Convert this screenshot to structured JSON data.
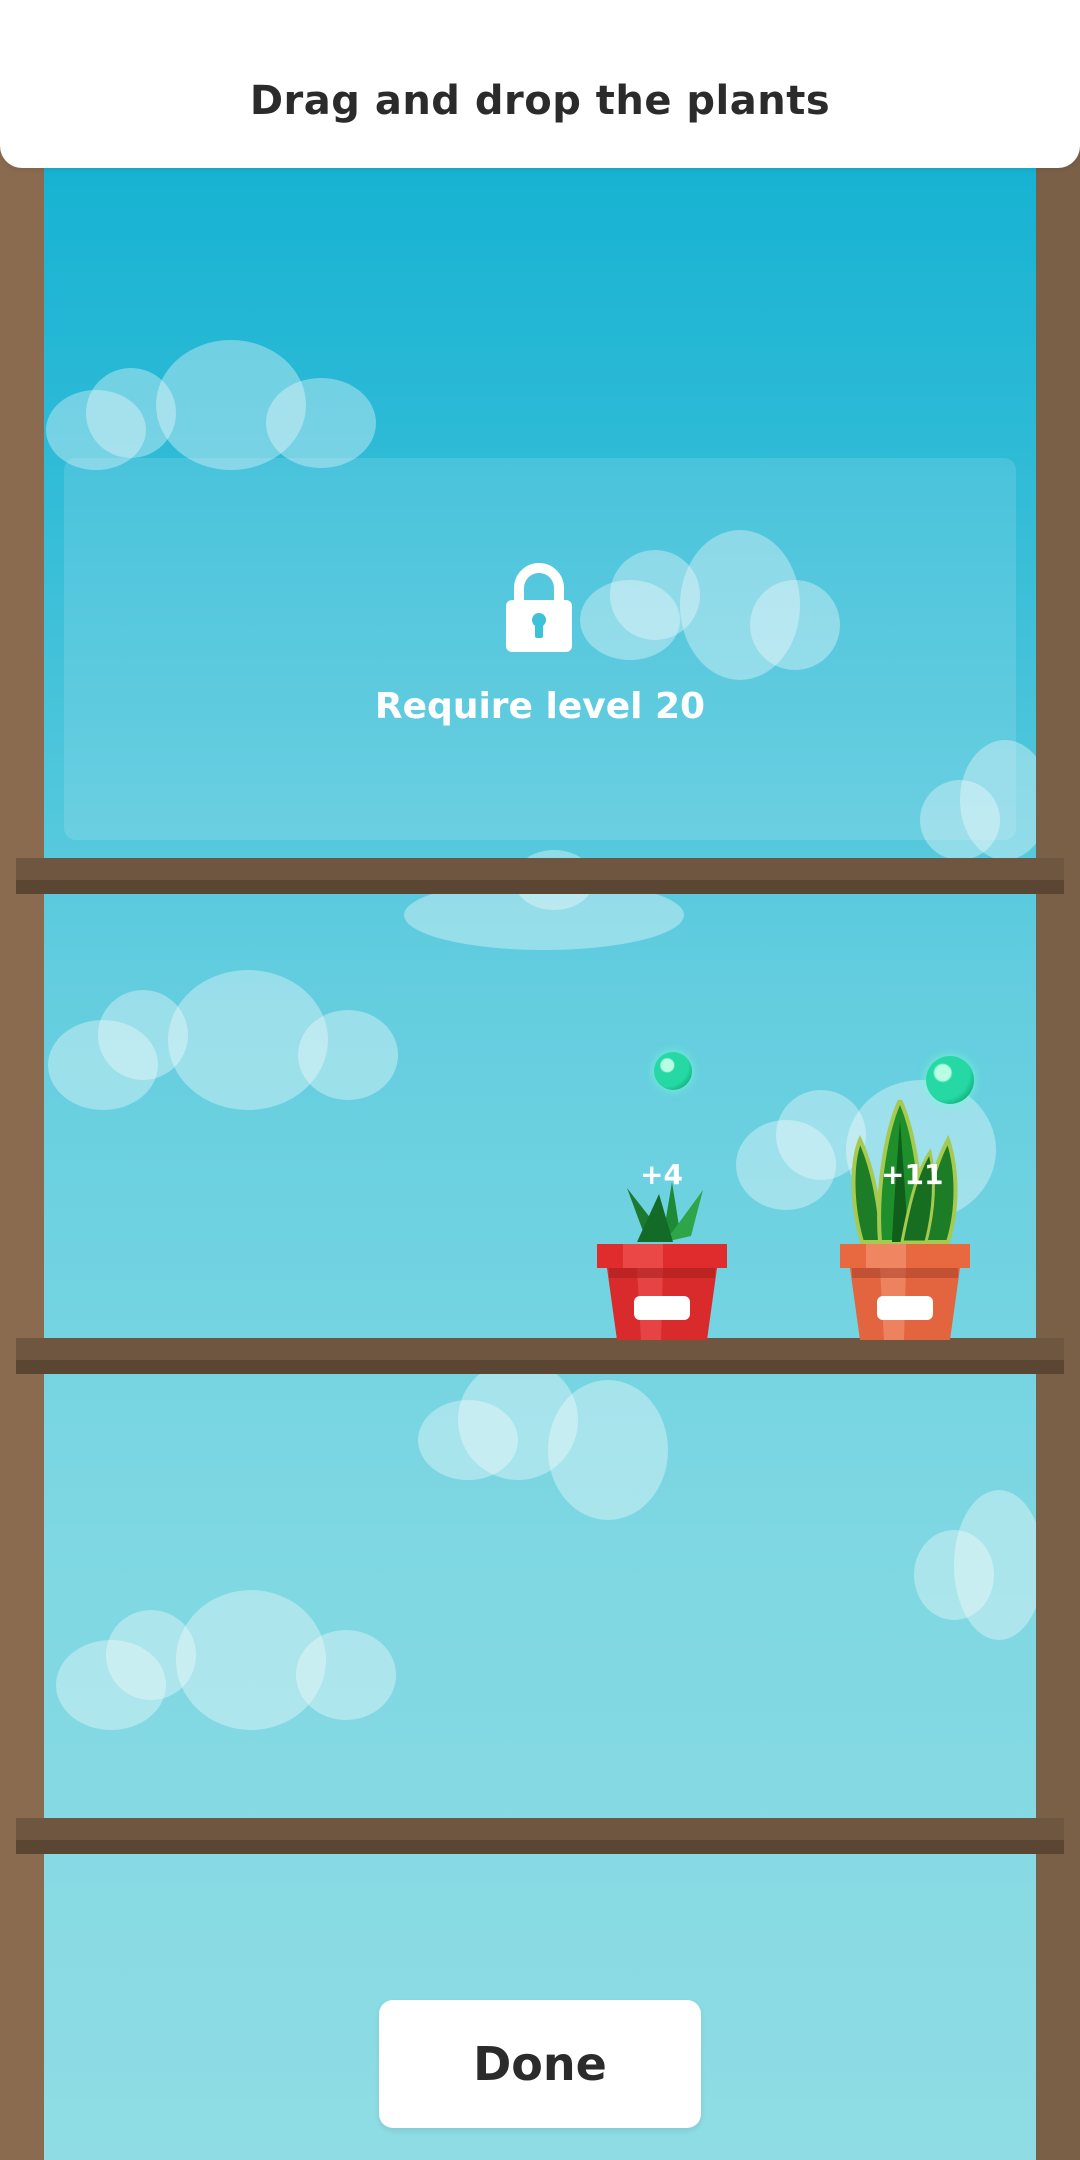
{
  "header": {
    "title": "Drag and drop the plants"
  },
  "shelves": [
    {
      "locked": true,
      "lock_text": "Require level 20"
    },
    {
      "locked": false,
      "plants": [
        {
          "name": "aloe",
          "pot_color": "#d92b2b",
          "bonus": "+4"
        },
        {
          "name": "snake-plant",
          "pot_color": "#e2653f",
          "bonus": "+11"
        }
      ]
    },
    {
      "locked": false
    },
    {
      "locked": false
    }
  ],
  "footer": {
    "done_label": "Done"
  },
  "colors": {
    "sky_top": "#0aaed1",
    "sky_bottom": "#8fdce4",
    "wood": "#7b6048",
    "drop": "#26d9a4"
  }
}
